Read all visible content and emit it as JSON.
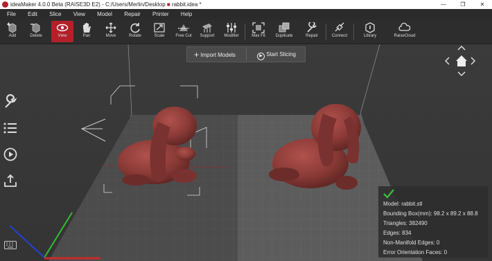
{
  "window": {
    "title": "ideaMaker 4.0.0 Beta (RAISE3D E2) - C:/Users/Merlin/Desktop",
    "file_name": "rabbit.idea *",
    "brand_color": "#b3202a"
  },
  "menu": [
    "File",
    "Edit",
    "Slice",
    "View",
    "Model",
    "Repair",
    "Printer",
    "Help"
  ],
  "toolbar": [
    {
      "label": "Add",
      "icon": "add-cube-icon"
    },
    {
      "label": "Delete",
      "icon": "delete-cube-icon"
    },
    {
      "label": "View",
      "icon": "eye-icon",
      "active": true
    },
    {
      "label": "Pan",
      "icon": "hand-icon"
    },
    {
      "label": "Move",
      "icon": "move-arrows-icon"
    },
    {
      "label": "Rotate",
      "icon": "rotate-icon"
    },
    {
      "label": "Scale",
      "icon": "scale-icon"
    },
    {
      "label": "Free Cut",
      "icon": "cut-icon"
    },
    {
      "label": "Support",
      "icon": "support-icon"
    },
    {
      "label": "Modifier",
      "icon": "modifier-sliders-icon"
    },
    {
      "label": "Max Fit",
      "icon": "max-fit-icon"
    },
    {
      "label": "Duplicate",
      "icon": "duplicate-icon"
    },
    {
      "label": "Repair",
      "icon": "repair-wrench-icon"
    },
    {
      "label": "Connect",
      "icon": "connect-icon"
    },
    {
      "label": "Library",
      "icon": "library-icon"
    },
    {
      "label": "RaiseCloud",
      "icon": "cloud-icon"
    }
  ],
  "actions": {
    "import_models": "Import Models",
    "start_slicing": "Start Slicing"
  },
  "left_tools": [
    "wrench-icon",
    "list-icon",
    "play-icon",
    "upload-icon"
  ],
  "info_panel": {
    "model": "Model: rabbit.stl",
    "bounding_box": "Bounding Box(mm): 98.2 x 89.2 x 88.8",
    "triangles": "Triangles: 382490",
    "edges": "Edges: 834",
    "non_manifold": "Non-Manifold Edges: 0",
    "error_faces": "Error Orientation Faces: 0",
    "status_color": "#3dbb3d"
  },
  "model_color": "#8a3a36"
}
